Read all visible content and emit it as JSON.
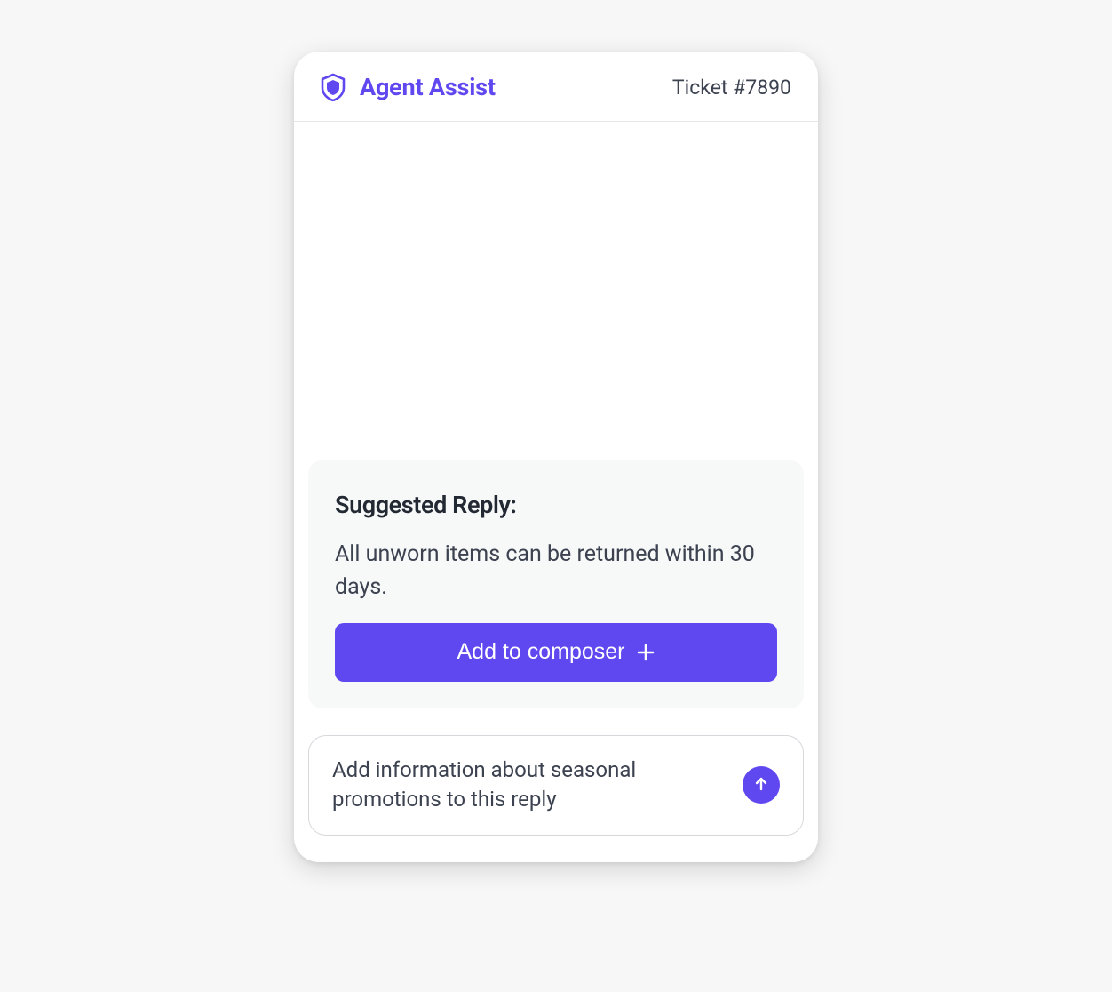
{
  "header": {
    "brand_title": "Agent Assist",
    "ticket_label": "Ticket #7890"
  },
  "suggestion": {
    "title": "Suggested Reply:",
    "body": "All unworn items can be returned within 30 days.",
    "add_label": "Add to composer"
  },
  "composer": {
    "value": "Add information about seasonal promotions to this reply"
  },
  "colors": {
    "accent": "#5f48f0"
  }
}
